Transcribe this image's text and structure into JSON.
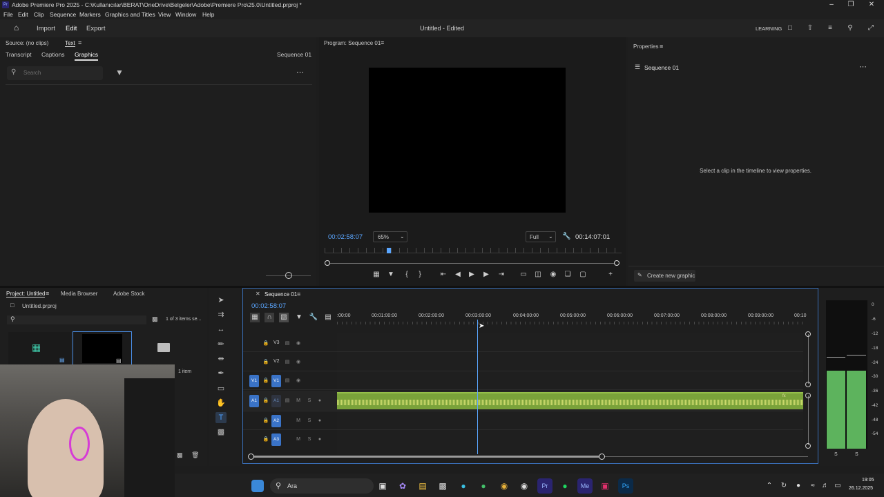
{
  "window": {
    "title": "Adobe Premiere Pro 2025 - C:\\Kullanıcılar\\BERAT\\OneDrive\\Belgeler\\Adobe\\Premiere Pro\\25.0\\Untitled.prproj *"
  },
  "menu": [
    "File",
    "Edit",
    "Clip",
    "Sequence",
    "Markers",
    "Graphics and Titles",
    "View",
    "Window",
    "Help"
  ],
  "appbar": {
    "import": "Import",
    "edit": "Edit",
    "export": "Export",
    "doc_title": "Untitled - Edited",
    "workspace": "LEARNING"
  },
  "source_panel": {
    "tab_source": "Source: (no clips)",
    "tab_text": "Text",
    "tabs": [
      "Transcript",
      "Captions",
      "Graphics"
    ],
    "sequence": "Sequence 01",
    "search_placeholder": "Search"
  },
  "program_panel": {
    "title": "Program: Sequence 01",
    "timecode": "00:02:58:07",
    "zoom": "65%",
    "quality": "Full",
    "duration": "00:14:07:01",
    "playhead_fraction": 0.21
  },
  "properties_panel": {
    "title": "Properties",
    "sequence": "Sequence 01",
    "hint": "Select a clip in the timeline to view properties.",
    "create_button": "Create new graphic"
  },
  "project_panel": {
    "tab_project": "Project: Untitled",
    "tab_media": "Media Browser",
    "tab_stock": "Adobe Stock",
    "file": "Untitled.prproj",
    "count": "1 of 3 items se...",
    "item_label": "1 item"
  },
  "timeline": {
    "tab": "Sequence 01",
    "timecode": "00:02:58:07",
    "ruler": [
      ":00:00",
      "00:01:00:00",
      "00:02:00:00",
      "00:03:00:00",
      "00:04:00:00",
      "00:05:00:00",
      "00:06:00:00",
      "00:07:00:00",
      "00:08:00:00",
      "00:09:00:00",
      "00:10"
    ],
    "video_tracks": [
      "V3",
      "V2",
      "V1"
    ],
    "audio_tracks": [
      "A1",
      "A2",
      "A3"
    ],
    "source_v": "V1",
    "source_a": "A1",
    "mute": "M",
    "solo": "S"
  },
  "meter": {
    "scale": [
      "0",
      "-6",
      "-12",
      "-18",
      "-24",
      "-30",
      "-36",
      "-42",
      "-48",
      "-54"
    ],
    "channels": [
      "S",
      "S"
    ]
  },
  "taskbar": {
    "search": "Ara",
    "time": "19:05",
    "date": "26.12.2025"
  },
  "colors": {
    "accent": "#2d8ceb",
    "track_blue": "#3a73c7",
    "audio_clip": "#7aa23a",
    "meter_green": "#5db35d"
  }
}
